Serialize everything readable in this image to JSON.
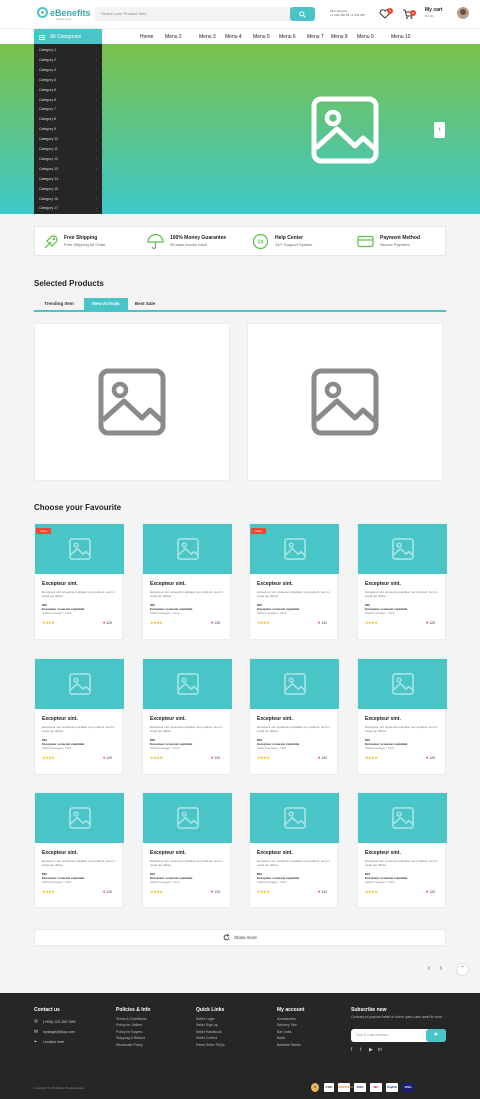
{
  "header": {
    "logo": "eBenefits",
    "logo_sub": "online store",
    "search_placeholder": "Search your Product here",
    "support_line1": "24/7 Support",
    "support_line2": "+1 234 456 55 +1 234 567",
    "wishlist_count": "0",
    "cart_count": "0",
    "cart_title": "My cart",
    "cart_amount": "$ 0.00"
  },
  "nav": {
    "all_categories": "All Categories",
    "menus": [
      "Home",
      "Menu 2",
      "Menu 3",
      "Menu 4",
      "Menu 5",
      "Menu 6",
      "Menu 7",
      "Menu 8",
      "Menu 9",
      "Menu 10"
    ]
  },
  "categories": [
    "Category 1",
    "Category 2",
    "Category 3",
    "Category 4",
    "Category 5",
    "Category 6",
    "Category 7",
    "Category 8",
    "Category 9",
    "Category 10",
    "Category 11",
    "Category 12",
    "Category 13",
    "Category 14",
    "Category 15",
    "Category 16",
    "Category 17"
  ],
  "features": [
    {
      "title": "Free Shipping",
      "sub": "Free Shipping All Order",
      "icon": "rocket-icon"
    },
    {
      "title": "100% Money Guarantee",
      "sub": "30 days money back",
      "icon": "umbrella-icon"
    },
    {
      "title": "Help Center",
      "sub": "24/7 Support System",
      "icon": "support-24-icon"
    },
    {
      "title": "Payment Method",
      "sub": "Secure Payment",
      "icon": "card-icon"
    }
  ],
  "selected": {
    "title": "Selected Products",
    "tabs": [
      "Trending Item",
      "New Arrivals",
      "Best Sale"
    ],
    "active_tab": "New Arrivals"
  },
  "favourite": {
    "title": "Choose your Favourite",
    "new_label": "New",
    "product": {
      "title": "Excepteur sint.",
      "desc": "Excepteur sint occaecat cupidatat non proident, sunt in culpa qui officia.",
      "price": "$00",
      "info": "Excepteur occaecat cupidatat",
      "seller": "Seller/manager / Yash",
      "stars": "★★★★",
      "likes": "120"
    }
  },
  "show_more": "Show more",
  "footer": {
    "contact": {
      "title": "Contact us",
      "phone": "(+606) 123 456 7890",
      "email": "mystage@shop.com",
      "location": "Location here"
    },
    "policies": {
      "title": "Policies & Info",
      "items": [
        "Terms & Conditions",
        "Policy for Sellers",
        "Policy for Buyers",
        "Shipping & Refund",
        "Wholesale Policy"
      ]
    },
    "quick": {
      "title": "Quick Links",
      "items": [
        "Seller Login",
        "Seller Sign up",
        "Seller Handbook",
        "Seller Control",
        "Panel Seller FAQs"
      ]
    },
    "account": {
      "title": "My account",
      "items": [
        "Accessories",
        "Delivery Tale",
        "Bar Units",
        "Beds",
        "Bedside Tables"
      ]
    },
    "subscribe": {
      "title": "Subscribe now",
      "text": "Contrary to popular belief of lorem Ipsm Latin amet ltr from.",
      "placeholder": "Your E-mail address..."
    },
    "copyright": "Copyright © 2019 Best Wordtemplate",
    "payments": [
      "$",
      "COD",
      "DISCOVER",
      "VISA",
      "MC",
      "PayPal",
      "VISA"
    ]
  },
  "colors": {
    "accent": "#49c5c8",
    "hero_top": "#7bc24b",
    "hero_bottom": "#3ec9c9",
    "badge": "#e84b2f",
    "dark": "#262626"
  }
}
